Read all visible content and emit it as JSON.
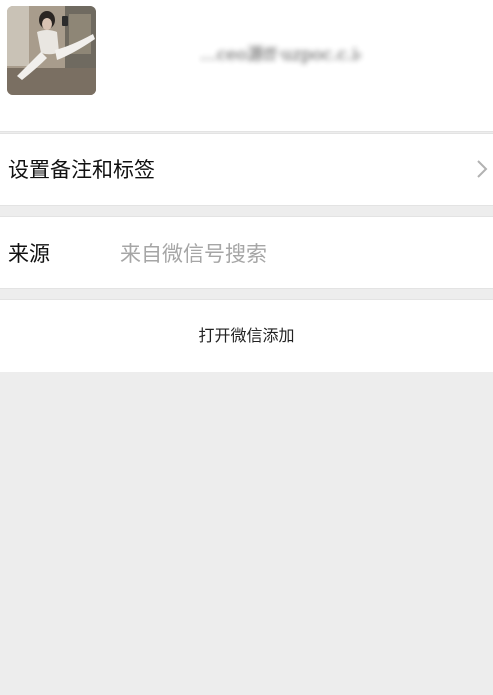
{
  "profile": {
    "avatar_icon": "user-photo",
    "wechat_id": "…ceo源ff·uzpoc.c.ic"
  },
  "remark_row": {
    "label": "设置备注和标签",
    "chevron_icon": "chevron-right-icon"
  },
  "source_row": {
    "label": "来源",
    "value": "来自微信号搜索"
  },
  "action_row": {
    "label": "打开微信添加"
  },
  "colors": {
    "background": "#ededed",
    "card": "#ffffff",
    "primary_text": "#111111",
    "secondary_text": "#a6a6a6",
    "divider": "#e3e3e3"
  }
}
